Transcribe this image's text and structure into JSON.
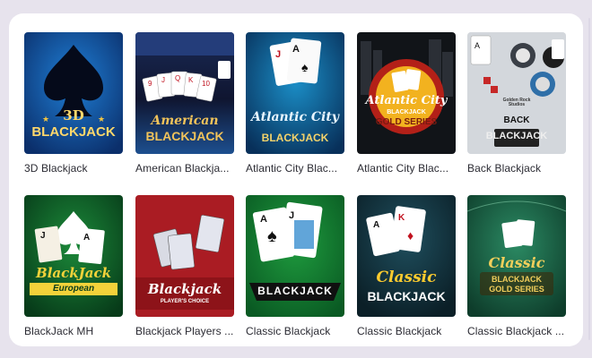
{
  "games": [
    {
      "caption": "3D Blackjack",
      "art_line1": "3D",
      "art_line2": "BLACKJACK"
    },
    {
      "caption": "American Blackja...",
      "art_line1": "American",
      "art_line2": "BLACKJACK"
    },
    {
      "caption": "Atlantic City Blac...",
      "art_line1": "Atlantic City",
      "art_line2": "BLACKJACK"
    },
    {
      "caption": "Atlantic City Blac...",
      "art_line1": "Atlantic City",
      "art_line2": "BLACKJACK",
      "art_line3": "GOLD SERIES"
    },
    {
      "caption": "Back Blackjack",
      "art_line1": "BACK",
      "art_line2": "BLACKJACK",
      "art_line3": "Golden Rock Studios"
    },
    {
      "caption": "BlackJack MH",
      "art_line1": "BlackJack",
      "art_line2": "European"
    },
    {
      "caption": "Blackjack Players ...",
      "art_line1": "Blackjack",
      "art_line2": "PLAYER'S CHOICE"
    },
    {
      "caption": "Classic Blackjack",
      "art_line1": "BLACKJACK"
    },
    {
      "caption": "Classic Blackjack",
      "art_line1": "Classic",
      "art_line2": "BLACKJACK"
    },
    {
      "caption": "Classic Blackjack ...",
      "art_line1": "Classic",
      "art_line2": "BLACKJACK",
      "art_line3": "GOLD SERIES"
    }
  ],
  "colors": {
    "page_bg": "#e7e3ed",
    "panel_bg": "#ffffff",
    "caption_text": "#2b2b33"
  }
}
